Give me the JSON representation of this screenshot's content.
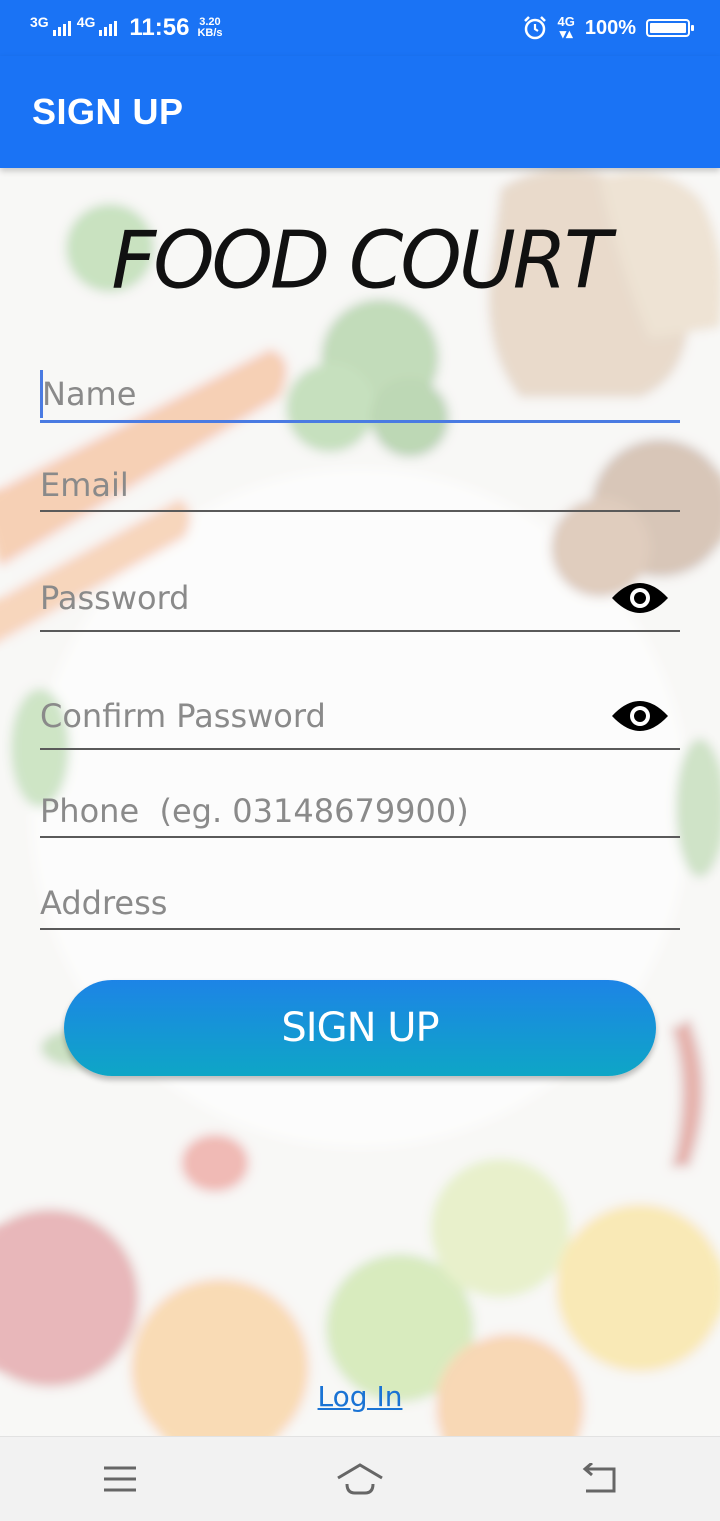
{
  "status_bar": {
    "signal1_label": "3G",
    "signal2_label": "4G",
    "time": "11:56",
    "speed_value": "3.20",
    "speed_unit": "KB/s",
    "network_label": "4G",
    "battery_percent": "100%",
    "battery_level": 1.0
  },
  "app_bar": {
    "title": "SIGN UP"
  },
  "brand": {
    "text": "FOOD COURT"
  },
  "form": {
    "name_placeholder": "Name",
    "email_placeholder": "Email",
    "password_placeholder": "Password",
    "confirm_password_placeholder": "Confirm Password",
    "phone_placeholder": "Phone  (eg. 03148679900)",
    "address_placeholder": "Address"
  },
  "buttons": {
    "signup_label": "SIGN UP",
    "login_label": "Log In"
  },
  "colors": {
    "primary": "#1a73f5",
    "button_top": "#1d84e6",
    "button_bottom": "#0ea6c6",
    "focus": "#4a7be2",
    "link": "#1a73d4"
  },
  "icons": {
    "password_toggle": "eye-icon",
    "confirm_toggle": "eye-icon",
    "nav_menu": "menu-icon",
    "nav_home": "home-icon",
    "nav_back": "back-icon"
  }
}
